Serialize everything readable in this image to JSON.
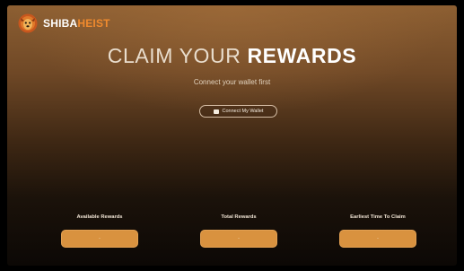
{
  "brand": {
    "name_part1": "SHIBA",
    "name_part2": "HEIST",
    "icon": "lion-head-icon"
  },
  "hero": {
    "title_light": "CLAIM YOUR",
    "title_bold": "REWARDS",
    "subtitle": "Connect your wallet first"
  },
  "connect_button": {
    "label": "Connect My Wallet",
    "icon": "wallet-icon"
  },
  "stats": [
    {
      "label": "Available Rewards",
      "value": "-"
    },
    {
      "label": "Total Rewards",
      "value": "-"
    },
    {
      "label": "Earliest Time To Claim",
      "value": "-"
    }
  ],
  "colors": {
    "accent_orange": "#f08a2e",
    "stat_button": "#d9923f",
    "background_top": "#8d5f32",
    "background_bottom": "#0c0805"
  }
}
